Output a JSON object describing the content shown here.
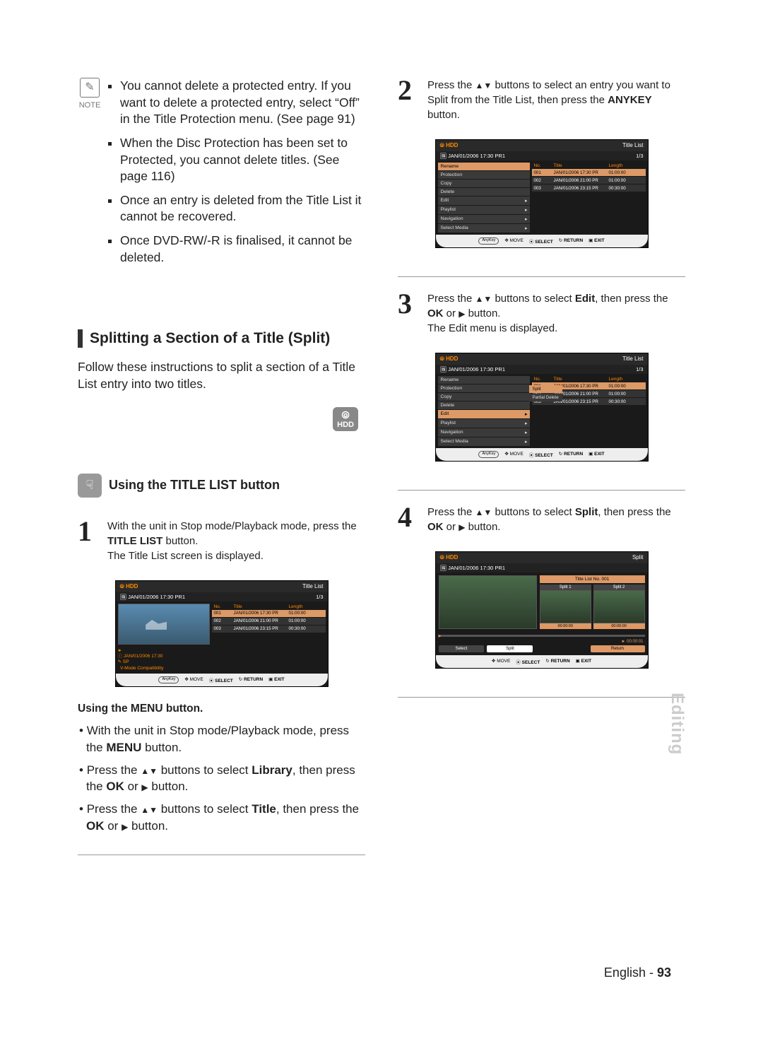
{
  "note": {
    "label": "NOTE",
    "items": [
      "You cannot delete a protected entry. If you want to delete a protected entry, select “Off” in the Title Protection menu. (See page 91)",
      "When the Disc Protection has been set to Protected, you cannot delete titles. (See page 116)",
      "Once an entry is deleted from the Title List it cannot be recovered.",
      "Once DVD-RW/-R is finalised, it cannot be deleted."
    ]
  },
  "section": {
    "title": "Splitting a Section of a Title (Split)",
    "desc": "Follow these instructions to split a section of a Title List entry into two titles.",
    "hdd": "HDD"
  },
  "subTitle": "Using the TITLE LIST button",
  "step1": {
    "line1_a": "With the unit in Stop mode/Playback mode, press the ",
    "line1_b": "TITLE LIST",
    "line1_c": " button.",
    "line2": "The Title List screen is displayed."
  },
  "osd_common": {
    "hdd": "HDD",
    "titleList": "Title List",
    "split": "Split",
    "date": "JAN/01/2006 17:30 PR1",
    "count": "1/3",
    "hdr_no": "No.",
    "hdr_title": "Title",
    "hdr_length": "Length",
    "meta1": "JAN/01/2006 17:30",
    "meta2": "SP",
    "meta3": "V-Mode Compatibility",
    "rows": [
      {
        "no": "001",
        "title": "JAN/01/2006 17:30 PR",
        "len": "01:00:00"
      },
      {
        "no": "002",
        "title": "JAN/01/2006 21:00 PR",
        "len": "01:00:00"
      },
      {
        "no": "003",
        "title": "JAN/01/2006 23:15 PR",
        "len": "00:30:00"
      }
    ],
    "foot_any": "AnyKey",
    "foot_move": "MOVE",
    "foot_select": "SELECT",
    "foot_return": "RETURN",
    "foot_exit": "EXIT"
  },
  "osd_menu": {
    "items": [
      "Rename",
      "Protection",
      "Copy",
      "Delete",
      "Edit",
      "Playlist",
      "Navigation",
      "Select Media"
    ]
  },
  "osd_edit_sub": {
    "items": [
      "Split",
      "Partial Delete"
    ]
  },
  "osd_split_screen": {
    "titleNo": "Title List No. 001",
    "s1": "Split 1",
    "s2": "Split 2",
    "t1": "00:00:00",
    "t2": "00:00:00",
    "elapsed": "00:00:01",
    "btn_select": "Select",
    "btn_split": "Split",
    "btn_return": "Return"
  },
  "usingMenu": {
    "h": "Using the MENU button.",
    "b1_a": "With the unit in Stop mode/Playback mode, press the ",
    "b1_b": "MENU",
    "b1_c": " button.",
    "b2_a": "Press the ",
    "b2_b": " buttons to select ",
    "b2_c": "Library",
    "b2_d": ", then press the ",
    "b2_e": "OK",
    "b2_f": " or ",
    "b2_g": " button.",
    "b3_c": "Title"
  },
  "step2": {
    "a": "Press the ",
    "b": " buttons to select an entry you want to Split from the Title List, then press the ",
    "c": "ANYKEY",
    "d": " button."
  },
  "step3": {
    "a": "Press the ",
    "b": " buttons to select ",
    "c": "Edit",
    "d": ", then press the ",
    "e": "OK",
    "f": " or ",
    "g": " button.",
    "line2": "The Edit menu is displayed."
  },
  "step4": {
    "a": "Press the ",
    "b": " buttons to select ",
    "c": "Split",
    "d": ", then press the ",
    "e": "OK",
    "f": " or ",
    "g": " button."
  },
  "sideTab": "Editing",
  "footer": {
    "lang": "English",
    "sep": " - ",
    "page": "93"
  }
}
